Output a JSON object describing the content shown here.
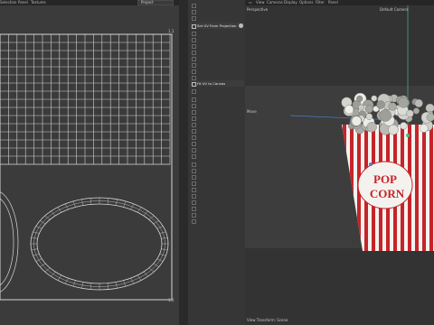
{
  "main_menu": {
    "items": [
      "Selection",
      "Panel",
      "Textures"
    ]
  },
  "uv_editor": {
    "project_dropdown": "Project",
    "corner_top_right": "1,1",
    "corner_bottom_right": "1,0"
  },
  "tool_panel": {
    "items": [
      {
        "label": "Set UV From Projection",
        "active": true
      },
      {
        "label": "Fit UV to Canvas",
        "active": true
      }
    ]
  },
  "viewport": {
    "menu": [
      "View",
      "Cameras",
      "Display",
      "Options",
      "Filter",
      "Panel"
    ],
    "view_name": "Perspective",
    "camera": "Default Camera",
    "move_label": "Move",
    "footer": "View Transform: Scene"
  },
  "popcorn": {
    "text_line1": "POP",
    "text_line2": "CORN"
  },
  "colors": {
    "accent_red": "#c5242a",
    "stripe_white": "#f4f2ee",
    "axis_green": "#3fbf86",
    "axis_blue": "#4a7fd6",
    "grid_line": "#d4d4d4"
  }
}
